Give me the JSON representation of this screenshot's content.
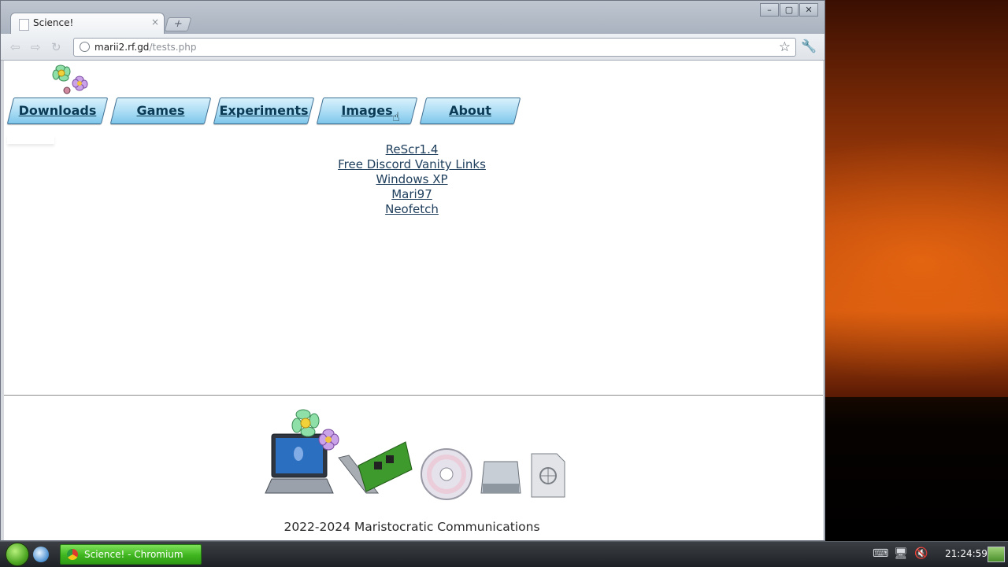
{
  "browser": {
    "tab_title": "Science!",
    "tab_close": "×",
    "new_tab": "+",
    "url_host": "marii2.rf.gd",
    "url_path": "/tests.php",
    "window_buttons": [
      "–",
      "▢",
      "✕"
    ]
  },
  "site": {
    "nav": [
      {
        "label": "Downloads"
      },
      {
        "label": "Games"
      },
      {
        "label": "Experiments"
      },
      {
        "label": "Images"
      },
      {
        "label": "About"
      }
    ],
    "links": [
      {
        "label": "ReScr1.4"
      },
      {
        "label": "Free Discord Vanity Links"
      },
      {
        "label": "Windows XP"
      },
      {
        "label": "Mari97"
      },
      {
        "label": "Neofetch"
      }
    ],
    "footer_text": "2022-2024 Maristocratic Communications"
  },
  "taskbar": {
    "task_label": "Science! - Chromium",
    "clock": "21:24:59"
  },
  "icons": {
    "back": "back-arrow-icon",
    "forward": "forward-arrow-icon",
    "reload": "reload-icon",
    "star": "bookmark-star-icon",
    "wrench": "wrench-menu-icon"
  }
}
